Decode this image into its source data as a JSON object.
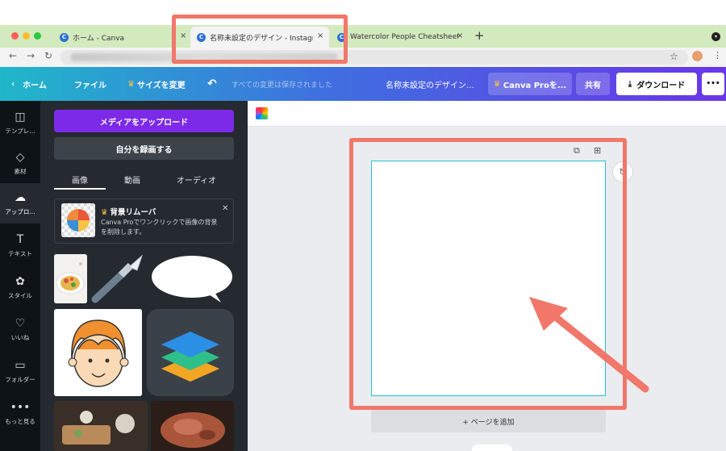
{
  "browser": {
    "tabs": [
      {
        "favicon": "C",
        "title": "ホーム - Canva"
      },
      {
        "favicon": "C",
        "title": "名称未設定のデザイン - Instagram"
      },
      {
        "favicon": "C",
        "title": "Watercolor People Cheatsheet"
      }
    ],
    "new_tab": "+",
    "close_glyph": "×"
  },
  "header": {
    "home": "ホーム",
    "file": "ファイル",
    "resize": "サイズを変更",
    "save_status": "すべての変更は保存されました",
    "design_name": "名称未設定のデザイン...",
    "canva_pro": "Canva Proを...",
    "share": "共有",
    "download": "ダウンロード",
    "more": "•••"
  },
  "rail": [
    {
      "icon": "template-icon",
      "label": "テンプレ..."
    },
    {
      "icon": "elements-icon",
      "label": "素材"
    },
    {
      "icon": "upload-icon",
      "label": "アップロ..."
    },
    {
      "icon": "text-icon",
      "label": "テキスト"
    },
    {
      "icon": "style-icon",
      "label": "スタイル"
    },
    {
      "icon": "heart-icon",
      "label": "いいね"
    },
    {
      "icon": "folder-icon",
      "label": "フォルダー"
    },
    {
      "icon": "more-icon",
      "label": "もっと見る"
    }
  ],
  "panel": {
    "upload_media": "メディアをアップロード",
    "record_self": "自分を録画する",
    "tabs": [
      "画像",
      "動画",
      "オーディオ"
    ],
    "promo": {
      "title": "背景リムーバ",
      "body": "Canva Proでワンクリックで画像の背景を削除します。"
    }
  },
  "canvas": {
    "add_page": "+ ページを追加"
  },
  "colors": {
    "highlight": "#f0776a",
    "upload_button": "#7d2ae8",
    "tab_bar": "#d3e9be"
  }
}
